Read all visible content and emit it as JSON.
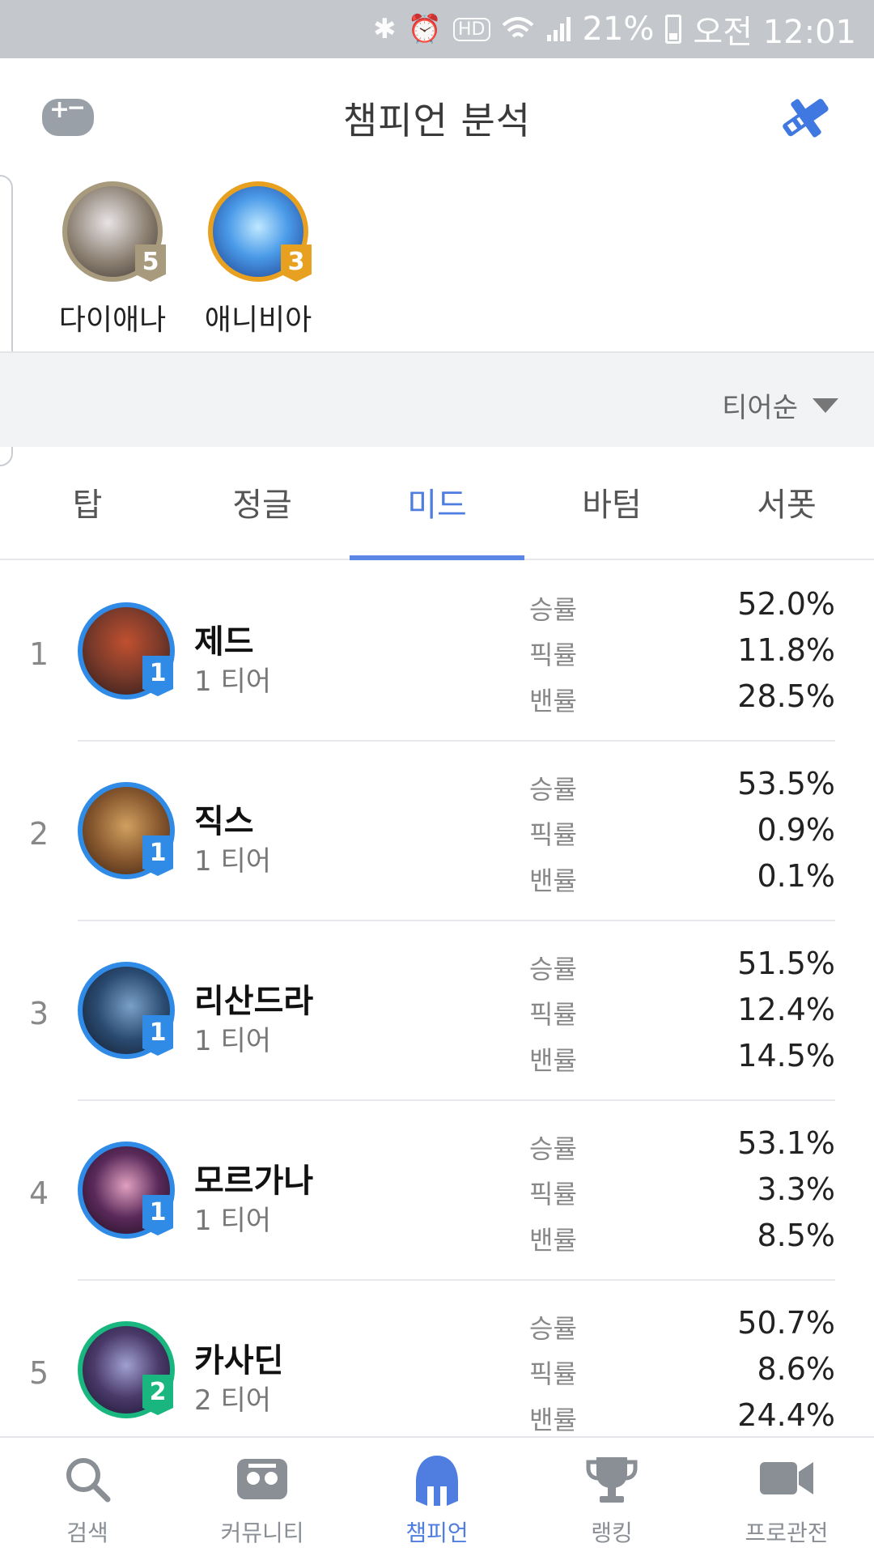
{
  "status_bar": {
    "battery": "21%",
    "time": "오전 12:01",
    "hd_label": "HD"
  },
  "header": {
    "title": "챔피언 분석"
  },
  "favorites": [
    {
      "name": "다이애나",
      "tier": "5",
      "badge_color": "#a89a7d",
      "portrait_color": "#8a7e70"
    },
    {
      "name": "애니비아",
      "tier": "3",
      "badge_color": "#e8a020",
      "portrait_color": "#2d6fd0"
    }
  ],
  "sort": {
    "label": "티어순"
  },
  "tabs": [
    {
      "label": "탑",
      "active": false
    },
    {
      "label": "정글",
      "active": false
    },
    {
      "label": "미드",
      "active": true
    },
    {
      "label": "바텀",
      "active": false
    },
    {
      "label": "서폿",
      "active": false
    }
  ],
  "stat_labels": {
    "win": "승률",
    "pick": "픽률",
    "ban": "밴률"
  },
  "champions": [
    {
      "rank": "1",
      "name": "제드",
      "tier_label": "1 티어",
      "tier": "1",
      "win": "52.0%",
      "pick": "11.8%",
      "ban": "28.5%",
      "portrait_color": "#7a3a2a"
    },
    {
      "rank": "2",
      "name": "직스",
      "tier_label": "1 티어",
      "tier": "1",
      "win": "53.5%",
      "pick": "0.9%",
      "ban": "0.1%",
      "portrait_color": "#8a5a30"
    },
    {
      "rank": "3",
      "name": "리산드라",
      "tier_label": "1 티어",
      "tier": "1",
      "win": "51.5%",
      "pick": "12.4%",
      "ban": "14.5%",
      "portrait_color": "#2a4a70"
    },
    {
      "rank": "4",
      "name": "모르가나",
      "tier_label": "1 티어",
      "tier": "1",
      "win": "53.1%",
      "pick": "3.3%",
      "ban": "8.5%",
      "portrait_color": "#5a2a5a"
    },
    {
      "rank": "5",
      "name": "카사딘",
      "tier_label": "2 티어",
      "tier": "2",
      "win": "50.7%",
      "pick": "8.6%",
      "ban": "24.4%",
      "portrait_color": "#4a3a6a"
    }
  ],
  "bottom_nav": [
    {
      "label": "검색",
      "icon": "search-icon",
      "active": false
    },
    {
      "label": "커뮤니티",
      "icon": "community-icon",
      "active": false
    },
    {
      "label": "챔피언",
      "icon": "champion-helmet-icon",
      "active": true
    },
    {
      "label": "랭킹",
      "icon": "trophy-icon",
      "active": false
    },
    {
      "label": "프로관전",
      "icon": "video-camera-icon",
      "active": false
    }
  ],
  "colors": {
    "accent": "#4f7de0",
    "tier1": "#2f8be6",
    "tier2": "#19b77f",
    "status_bar": "#c4c7cc"
  }
}
